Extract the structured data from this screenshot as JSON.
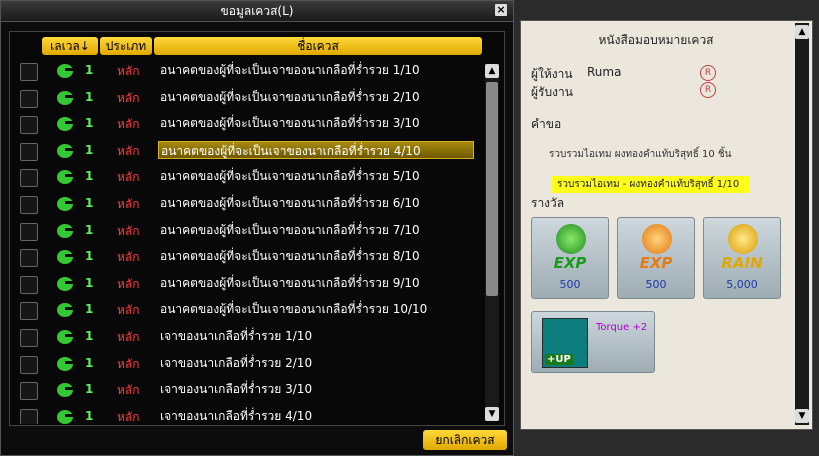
{
  "window": {
    "title": "ขอมูลเควส(L)",
    "close_glyph": "×"
  },
  "columns": {
    "level": "เลเวล↓",
    "type": "ประเภท",
    "name": "ชื่อเควส"
  },
  "quests": [
    {
      "level": "1",
      "type": "หลัก",
      "name": "อนาคตของผู้ที่จะเป็นเจาของนาเกลือที่ร่ำรวย 1/10",
      "selected": false
    },
    {
      "level": "1",
      "type": "หลัก",
      "name": "อนาคตของผู้ที่จะเป็นเจาของนาเกลือที่ร่ำรวย 2/10",
      "selected": false
    },
    {
      "level": "1",
      "type": "หลัก",
      "name": "อนาคตของผู้ที่จะเป็นเจาของนาเกลือที่ร่ำรวย 3/10",
      "selected": false
    },
    {
      "level": "1",
      "type": "หลัก",
      "name": "อนาคตของผู้ที่จะเป็นเจาของนาเกลือที่ร่ำรวย 4/10",
      "selected": true
    },
    {
      "level": "1",
      "type": "หลัก",
      "name": "อนาคตของผู้ที่จะเป็นเจาของนาเกลือที่ร่ำรวย 5/10",
      "selected": false
    },
    {
      "level": "1",
      "type": "หลัก",
      "name": "อนาคตของผู้ที่จะเป็นเจาของนาเกลือที่ร่ำรวย 6/10",
      "selected": false
    },
    {
      "level": "1",
      "type": "หลัก",
      "name": "อนาคตของผู้ที่จะเป็นเจาของนาเกลือที่ร่ำรวย 7/10",
      "selected": false
    },
    {
      "level": "1",
      "type": "หลัก",
      "name": "อนาคตของผู้ที่จะเป็นเจาของนาเกลือที่ร่ำรวย 8/10",
      "selected": false
    },
    {
      "level": "1",
      "type": "หลัก",
      "name": "อนาคตของผู้ที่จะเป็นเจาของนาเกลือที่ร่ำรวย 9/10",
      "selected": false
    },
    {
      "level": "1",
      "type": "หลัก",
      "name": "อนาคตของผู้ที่จะเป็นเจาของนาเกลือที่ร่ำรวย 10/10",
      "selected": false
    },
    {
      "level": "1",
      "type": "หลัก",
      "name": "เจาของนาเกลือที่ร่ำรวย 1/10",
      "selected": false
    },
    {
      "level": "1",
      "type": "หลัก",
      "name": "เจาของนาเกลือที่ร่ำรวย 2/10",
      "selected": false
    },
    {
      "level": "1",
      "type": "หลัก",
      "name": "เจาของนาเกลือที่ร่ำรวย 3/10",
      "selected": false
    },
    {
      "level": "1",
      "type": "หลัก",
      "name": "เจาของนาเกลือที่ร่ำรวย 4/10",
      "selected": false
    }
  ],
  "buttons": {
    "cancel": "ยกเลิกเควส"
  },
  "scroll": {
    "up": "▲",
    "down": "▼"
  },
  "doc": {
    "title": "หนังสือมอบหมายเควส",
    "giver_label": "ผู้ให้งาน",
    "giver_name": "Ruma",
    "receiver_label": "ผู้รับงาน",
    "stamp": "R",
    "request_label": "คำขอ",
    "request_text": "รวบรวมไอเทม ผงทองคำแท้บริสุทธิ์ 10 ชิ้น",
    "progress_text": "รวบรวมไอเทม - ผงทองคำแท้บริสุทธิ์ 1/10",
    "reward_label": "รางวัล",
    "rewards": [
      {
        "label": "EXP",
        "value": "500",
        "color": "#22b022"
      },
      {
        "label": "EXP",
        "value": "500",
        "color": "#f08a10"
      },
      {
        "label": "RAIN",
        "value": "5,000",
        "color": "#f2b800"
      }
    ],
    "item": {
      "badge": "+UP",
      "text": "Torque +2"
    }
  }
}
